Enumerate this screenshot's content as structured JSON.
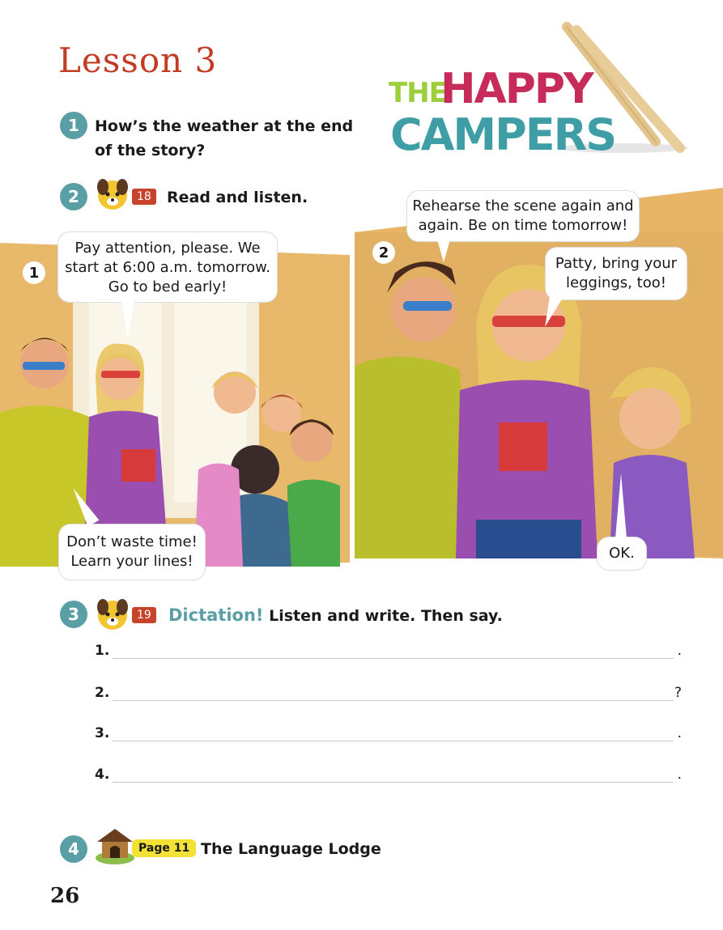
{
  "lesson_title": "Lesson 3",
  "logo": {
    "line1_a": "THE",
    "line1_b": "HAPPY",
    "line2": "CAMPERS"
  },
  "q1": {
    "number": "1",
    "text_line1": "How’s the weather at the end",
    "text_line2": "of the story?"
  },
  "q2": {
    "number": "2",
    "track": "18",
    "text": "Read and listen."
  },
  "panel1": {
    "number": "1",
    "bubble_top": [
      "Pay attention, please. We",
      "start at 6:00 a.m. tomorrow.",
      "Go to bed early!"
    ],
    "bubble_bottom": [
      "Don’t waste time!",
      "Learn your lines!"
    ]
  },
  "panel2": {
    "number": "2",
    "bubble_top": [
      "Rehearse the scene again and",
      "again. Be on time tomorrow!"
    ],
    "bubble_right": [
      "Patty, bring your",
      "leggings, too!"
    ],
    "bubble_ok": "OK."
  },
  "q3": {
    "number": "3",
    "track": "19",
    "title_colored": "Dictation!",
    "text": "Listen and write. Then say.",
    "lines": [
      {
        "num": "1.",
        "end": "."
      },
      {
        "num": "2.",
        "end": "?"
      },
      {
        "num": "3.",
        "end": "."
      },
      {
        "num": "4.",
        "end": "."
      }
    ]
  },
  "q4": {
    "number": "4",
    "badge": "Page 11",
    "text": "The Language Lodge"
  },
  "page_number": "26",
  "colors": {
    "title_red": "#c23b22",
    "teal": "#5a9ea6",
    "badge_yellow": "#f3e235"
  }
}
